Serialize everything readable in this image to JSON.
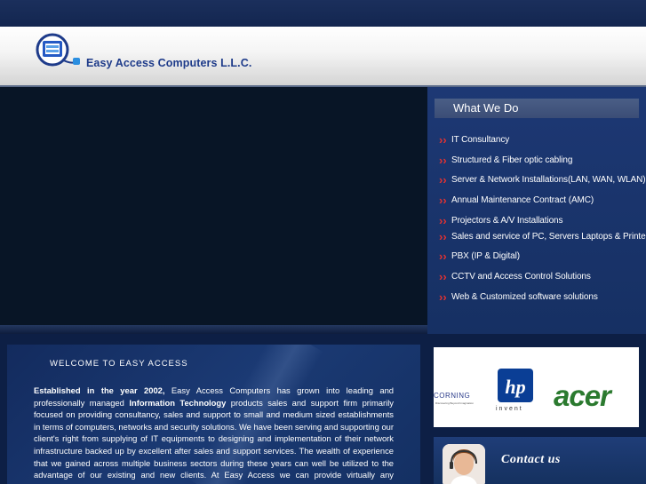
{
  "company": {
    "name": "Easy Access Computers L.L.C."
  },
  "services": {
    "title": "What We Do",
    "items": [
      {
        "label": "IT Consultancy"
      },
      {
        "label": "Structured & Fiber optic cabling"
      },
      {
        "label": "Server & Network Installations(LAN, WAN, WLAN)"
      },
      {
        "label": "Annual Maintenance Contract (AMC)"
      },
      {
        "label": "Projectors & A/V Installations"
      },
      {
        "label": "Sales and service of PC, Servers Laptops & Printers"
      },
      {
        "label": "PBX (IP & Digital)"
      },
      {
        "label": "CCTV and Access Control Solutions"
      },
      {
        "label": "Web & Customized software solutions"
      }
    ]
  },
  "welcome": {
    "title": "WELCOME TO EASY ACCESS",
    "bold_established": "Established in the year 2002,",
    "text_1": " Easy Access Computers has grown into leading and professionally managed ",
    "bold_it": "Information Technology",
    "text_2": " products sales and support firm primarily focused on providing consultancy, sales and support to small and medium sized establishments in terms of computers, networks and security solutions. We have been serving and supporting our client's right from supplying of IT equipments to designing and implementation of their network infrastructure backed up by excellent after sales and support services. The wealth of experience that we gained across multiple business sectors during these years can well be utilized to the advantage of our existing and new clients. At Easy Access we can provide virtually any technology solution your business"
  },
  "partners": {
    "corning": "CORNING",
    "corning_tagline": "Discovering Beyond Imagination",
    "hp_tagline": "invent",
    "acer": "acer"
  },
  "contact": {
    "label": "Contact us"
  },
  "colors": {
    "accent_arrow": "#e23232",
    "brand_blue": "#1e3b8a",
    "acer_green": "#2b7a2f"
  }
}
